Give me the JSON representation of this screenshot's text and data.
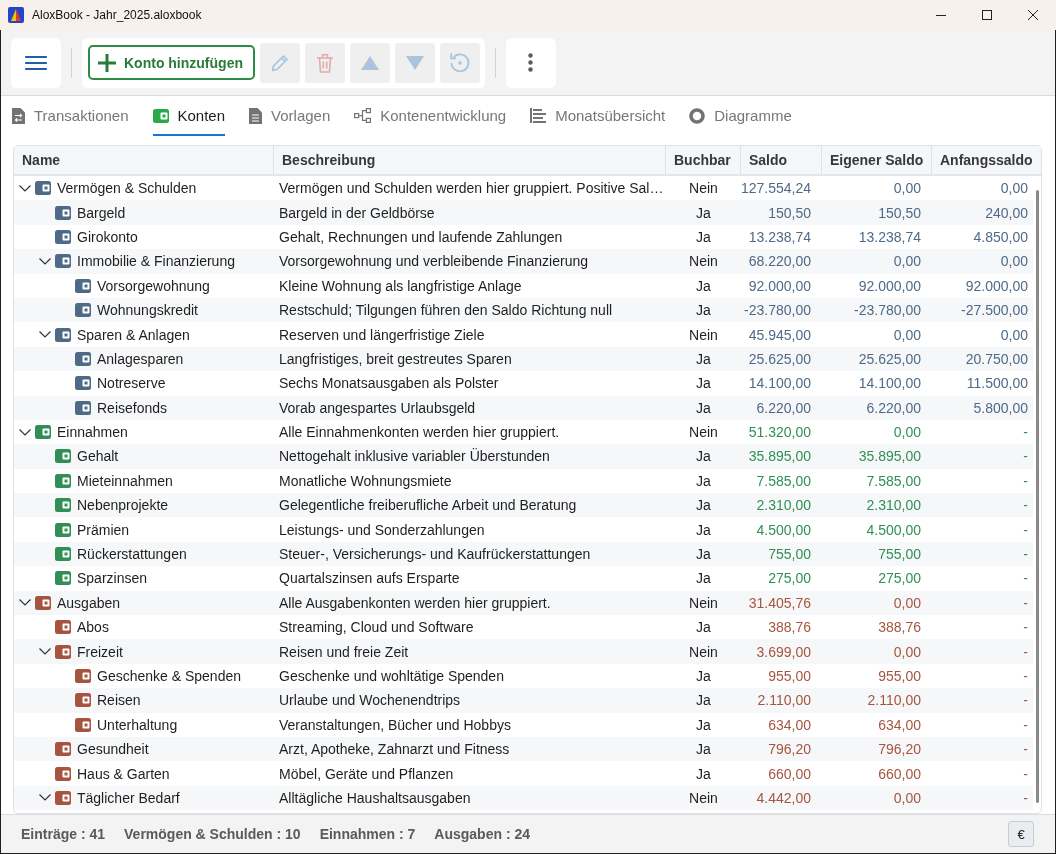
{
  "window": {
    "title": "AloxBook - Jahr_2025.aloxbook"
  },
  "toolbar": {
    "actions": [
      {
        "kind": "add",
        "label": "Konto hinzufügen",
        "disabled": false
      },
      {
        "kind": "edit",
        "disabled": true
      },
      {
        "kind": "delete",
        "disabled": true
      },
      {
        "kind": "up",
        "disabled": true
      },
      {
        "kind": "down",
        "disabled": true
      },
      {
        "kind": "reset",
        "disabled": true
      }
    ]
  },
  "tabs": [
    {
      "kind": "transactions",
      "label": "Transaktionen",
      "selected": false
    },
    {
      "kind": "accounts",
      "label": "Konten",
      "selected": true
    },
    {
      "kind": "templates",
      "label": "Vorlagen",
      "selected": false
    },
    {
      "kind": "development",
      "label": "Kontenentwicklung",
      "selected": false
    },
    {
      "kind": "monthly",
      "label": "Monatsübersicht",
      "selected": false
    },
    {
      "kind": "charts",
      "label": "Diagramme",
      "selected": false
    }
  ],
  "table": {
    "columns": [
      "Name",
      "Beschreibung",
      "Buchbar",
      "Saldo",
      "Eigener Saldo",
      "Anfangssaldo"
    ],
    "rows": [
      {
        "name": "Vermögen & Schulden",
        "description": "Vermögen und Schulden werden hier gruppiert. Positive Sal…",
        "bookable": "Nein",
        "balance": "127.554,24",
        "own_balance": "0,00",
        "opening_balance": "0,00",
        "color": "#4f6a86",
        "expanded": true,
        "children": [
          {
            "name": "Bargeld",
            "description": "Bargeld in der Geldbörse",
            "bookable": "Ja",
            "balance": "150,50",
            "own_balance": "150,50",
            "opening_balance": "240,00"
          },
          {
            "name": "Girokonto",
            "description": "Gehalt, Rechnungen und laufende Zahlungen",
            "bookable": "Ja",
            "balance": "13.238,74",
            "own_balance": "13.238,74",
            "opening_balance": "4.850,00"
          },
          {
            "name": "Immobilie & Finanzierung",
            "description": "Vorsorgewohnung und verbleibende Finanzierung",
            "bookable": "Nein",
            "balance": "68.220,00",
            "own_balance": "0,00",
            "opening_balance": "0,00",
            "expanded": true,
            "children": [
              {
                "name": "Vorsorgewohnung",
                "description": "Kleine Wohnung als langfristige Anlage",
                "bookable": "Ja",
                "balance": "92.000,00",
                "own_balance": "92.000,00",
                "opening_balance": "92.000,00"
              },
              {
                "name": "Wohnungskredit",
                "description": "Restschuld; Tilgungen führen den Saldo Richtung null",
                "bookable": "Ja",
                "balance": "-23.780,00",
                "own_balance": "-23.780,00",
                "opening_balance": "-27.500,00"
              }
            ]
          },
          {
            "name": "Sparen & Anlagen",
            "description": "Reserven und längerfristige Ziele",
            "bookable": "Nein",
            "balance": "45.945,00",
            "own_balance": "0,00",
            "opening_balance": "0,00",
            "expanded": true,
            "children": [
              {
                "name": "Anlagesparen",
                "description": "Langfristiges, breit gestreutes Sparen",
                "bookable": "Ja",
                "balance": "25.625,00",
                "own_balance": "25.625,00",
                "opening_balance": "20.750,00"
              },
              {
                "name": "Notreserve",
                "description": "Sechs Monatsausgaben als Polster",
                "bookable": "Ja",
                "balance": "14.100,00",
                "own_balance": "14.100,00",
                "opening_balance": "11.500,00"
              },
              {
                "name": "Reisefonds",
                "description": "Vorab angespartes Urlaubsgeld",
                "bookable": "Ja",
                "balance": "6.220,00",
                "own_balance": "6.220,00",
                "opening_balance": "5.800,00"
              }
            ]
          }
        ]
      },
      {
        "name": "Einnahmen",
        "description": "Alle Einnahmenkonten werden hier gruppiert.",
        "bookable": "Nein",
        "balance": "51.320,00",
        "own_balance": "0,00",
        "opening_balance": "-",
        "color": "#2f8f55",
        "expanded": true,
        "children": [
          {
            "name": "Gehalt",
            "description": "Nettogehalt inklusive variabler Überstunden",
            "bookable": "Ja",
            "balance": "35.895,00",
            "own_balance": "35.895,00",
            "opening_balance": "-"
          },
          {
            "name": "Mieteinnahmen",
            "description": "Monatliche Wohnungsmiete",
            "bookable": "Ja",
            "balance": "7.585,00",
            "own_balance": "7.585,00",
            "opening_balance": "-"
          },
          {
            "name": "Nebenprojekte",
            "description": "Gelegentliche freiberufliche Arbeit und Beratung",
            "bookable": "Ja",
            "balance": "2.310,00",
            "own_balance": "2.310,00",
            "opening_balance": "-"
          },
          {
            "name": "Prämien",
            "description": "Leistungs- und Sonderzahlungen",
            "bookable": "Ja",
            "balance": "4.500,00",
            "own_balance": "4.500,00",
            "opening_balance": "-"
          },
          {
            "name": "Rückerstattungen",
            "description": "Steuer-, Versicherungs- und Kaufrückerstattungen",
            "bookable": "Ja",
            "balance": "755,00",
            "own_balance": "755,00",
            "opening_balance": "-"
          },
          {
            "name": "Sparzinsen",
            "description": "Quartalszinsen aufs Ersparte",
            "bookable": "Ja",
            "balance": "275,00",
            "own_balance": "275,00",
            "opening_balance": "-"
          }
        ]
      },
      {
        "name": "Ausgaben",
        "description": "Alle Ausgabenkonten werden hier gruppiert.",
        "bookable": "Nein",
        "balance": "31.405,76",
        "own_balance": "0,00",
        "opening_balance": "-",
        "color": "#a5553f",
        "expanded": true,
        "children": [
          {
            "name": "Abos",
            "description": "Streaming, Cloud und Software",
            "bookable": "Ja",
            "balance": "388,76",
            "own_balance": "388,76",
            "opening_balance": "-"
          },
          {
            "name": "Freizeit",
            "description": "Reisen und freie Zeit",
            "bookable": "Nein",
            "balance": "3.699,00",
            "own_balance": "0,00",
            "opening_balance": "-",
            "expanded": true,
            "children": [
              {
                "name": "Geschenke & Spenden",
                "description": "Geschenke und wohltätige Spenden",
                "bookable": "Ja",
                "balance": "955,00",
                "own_balance": "955,00",
                "opening_balance": "-"
              },
              {
                "name": "Reisen",
                "description": "Urlaube und Wochenendtrips",
                "bookable": "Ja",
                "balance": "2.110,00",
                "own_balance": "2.110,00",
                "opening_balance": "-"
              },
              {
                "name": "Unterhaltung",
                "description": "Veranstaltungen, Bücher und Hobbys",
                "bookable": "Ja",
                "balance": "634,00",
                "own_balance": "634,00",
                "opening_balance": "-"
              }
            ]
          },
          {
            "name": "Gesundheit",
            "description": "Arzt, Apotheke, Zahnarzt und Fitness",
            "bookable": "Ja",
            "balance": "796,20",
            "own_balance": "796,20",
            "opening_balance": "-"
          },
          {
            "name": "Haus & Garten",
            "description": "Möbel, Geräte und Pflanzen",
            "bookable": "Ja",
            "balance": "660,00",
            "own_balance": "660,00",
            "opening_balance": "-"
          },
          {
            "name": "Täglicher Bedarf",
            "description": "Alltägliche Haushaltsausgaben",
            "bookable": "Nein",
            "balance": "4.442,00",
            "own_balance": "0,00",
            "opening_balance": "-",
            "expanded": true
          }
        ]
      }
    ]
  },
  "status_bar": {
    "counts": [
      "Einträge : 41",
      "Vermögen & Schulden : 10",
      "Einnahmen : 7",
      "Ausgaben : 24"
    ],
    "currency": "€"
  }
}
